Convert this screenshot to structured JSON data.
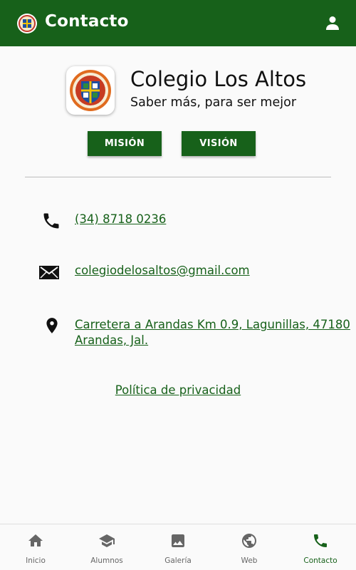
{
  "appbar": {
    "title": "Contacto"
  },
  "school": {
    "name": "Colegio Los Altos",
    "motto": "Saber más, para ser mejor"
  },
  "buttons": {
    "mision": "MISIÓN",
    "vision": "VISIÓN"
  },
  "contact": {
    "phone": "(34) 8718 0236",
    "email": "colegiodelosaltos@gmail.com",
    "address_line1": "Carretera a Arandas Km 0.9, Lagunillas, 47180",
    "address_line2": "Arandas, Jal."
  },
  "privacy": {
    "label": "Política de privacidad"
  },
  "nav": {
    "items": [
      {
        "label": "Inicio",
        "icon": "home-icon"
      },
      {
        "label": "Alumnos",
        "icon": "school-icon"
      },
      {
        "label": "Galería",
        "icon": "image-icon"
      },
      {
        "label": "Web",
        "icon": "globe-icon"
      },
      {
        "label": "Contacto",
        "icon": "phone-icon"
      }
    ],
    "active_index": 4
  },
  "colors": {
    "primary": "#17611a",
    "inactive": "#666666",
    "background": "#fafafa"
  }
}
